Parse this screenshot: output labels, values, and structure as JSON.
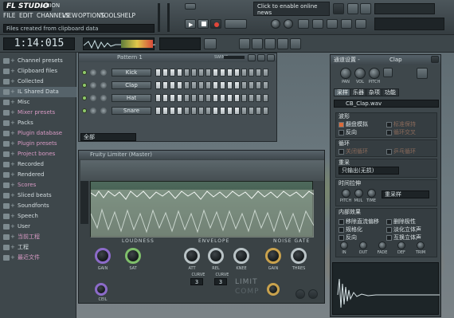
{
  "app": {
    "logo": "FL STUDIO",
    "project_name": "UNION"
  },
  "menu": [
    "FILE",
    "EDIT",
    "CHANNELS",
    "VIEW",
    "OPTIONS",
    "TOOLS",
    "HELP"
  ],
  "hint_bar": "Files created from clipboard data",
  "news": "Click to enable online news",
  "time_display": "1:14:015",
  "pattern_label": "Pattern 1",
  "channel_window": {
    "title": "Pattern 1",
    "filter_label": "全部",
    "swing_label": "SWING"
  },
  "channels": [
    {
      "name": "Kick"
    },
    {
      "name": "Clap"
    },
    {
      "name": "Hat"
    },
    {
      "name": "Snare"
    }
  ],
  "browser": {
    "items": [
      {
        "label": "Channel presets",
        "pink": false
      },
      {
        "label": "Clipboard files",
        "pink": false
      },
      {
        "label": "Collected",
        "pink": false
      },
      {
        "label": "IL Shared Data",
        "pink": false
      },
      {
        "label": "Misc",
        "pink": false
      },
      {
        "label": "Mixer presets",
        "pink": true
      },
      {
        "label": "Packs",
        "pink": false
      },
      {
        "label": "Plugin database",
        "pink": true
      },
      {
        "label": "Plugin presets",
        "pink": true
      },
      {
        "label": "Project bones",
        "pink": true
      },
      {
        "label": "Recorded",
        "pink": false
      },
      {
        "label": "Rendered",
        "pink": false
      },
      {
        "label": "Scores",
        "pink": true
      },
      {
        "label": "Sliced beats",
        "pink": false
      },
      {
        "label": "Soundfonts",
        "pink": false
      },
      {
        "label": "Speech",
        "pink": false
      },
      {
        "label": "User",
        "pink": false
      },
      {
        "label": "当前工程",
        "pink": true
      },
      {
        "label": "工程",
        "pink": false
      },
      {
        "label": "最近文件",
        "pink": true
      }
    ]
  },
  "limiter": {
    "title": "Fruity Limiter (Master)",
    "sections": [
      "LOUDNESS",
      "ENVELOPE",
      "NOISE GATE"
    ],
    "knobs": [
      "GAIN",
      "SAT",
      "CEIL",
      "ATT",
      "REL",
      "KNEE",
      "GAIN",
      "THRES"
    ],
    "curve_label": "CURVE",
    "curve_values": [
      "3",
      "3"
    ],
    "mode": "LIMIT",
    "comp": "COMP"
  },
  "channel_settings": {
    "title": "通道设置 -",
    "channel": "Clap",
    "knobs": [
      "PAN",
      "VOL",
      "PITCH"
    ],
    "tabs": [
      "采样",
      "乐器",
      "杂项",
      "功能"
    ],
    "file": "CB_Clap.wav",
    "wave_section": "波形",
    "wave_opts": [
      {
        "label": "翻盘模拟",
        "on": true
      },
      {
        "label": "标准保持",
        "on": false
      },
      {
        "label": "反向",
        "on": false
      },
      {
        "label": "循环交叉",
        "on": false
      }
    ],
    "loop_section": "循环",
    "loop_opts": [
      {
        "label": "关闭循环",
        "on": false
      },
      {
        "label": "乒乓循环",
        "on": false
      }
    ],
    "resample_section": "重采",
    "resample_value": "只输出(无损)",
    "time_section": "时间拉伸",
    "time_knobs": [
      "PITCH",
      "MUL",
      "TIME"
    ],
    "time_mode": "重采样",
    "precompute_section": "内部效果",
    "precompute_opts": [
      {
        "label": "移除直流偏移",
        "on": false
      },
      {
        "label": "删除极性",
        "on": false
      },
      {
        "label": "规格化",
        "on": false
      },
      {
        "label": "淡化立体声",
        "on": false
      },
      {
        "label": "反向",
        "on": false
      },
      {
        "label": "互换立体声",
        "on": false
      }
    ],
    "fx_knobs": [
      "IN",
      "OUT",
      "FADE",
      "DEF",
      "TRIM"
    ]
  }
}
